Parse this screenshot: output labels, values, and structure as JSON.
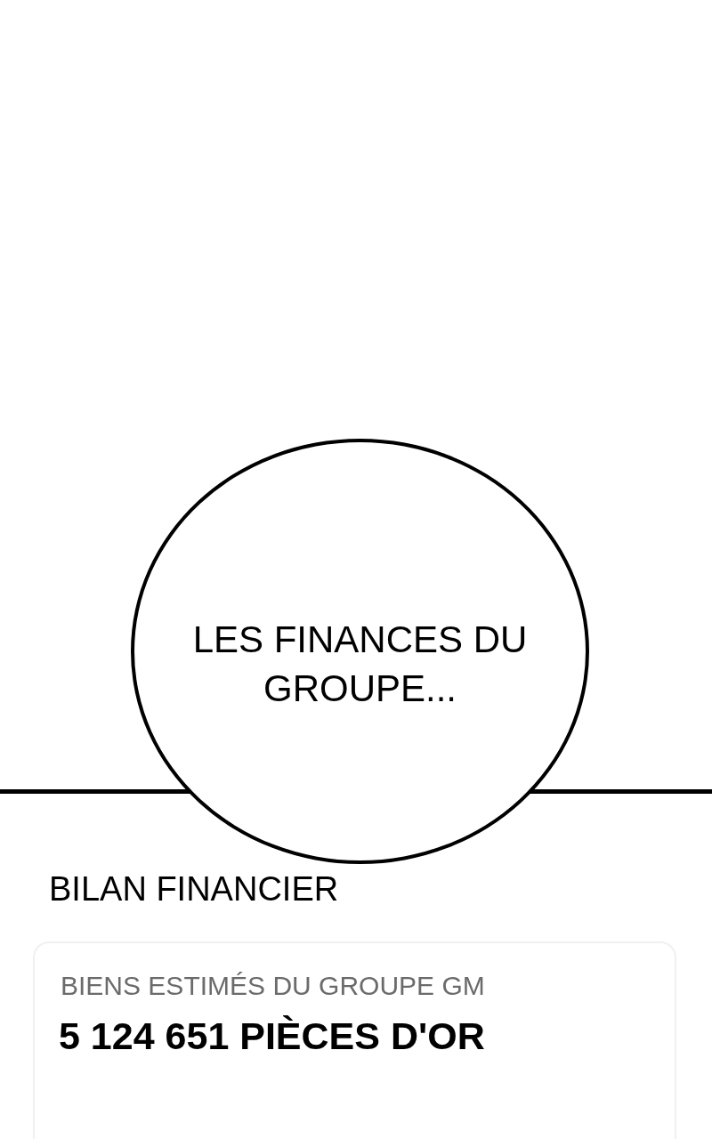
{
  "speech_bubble": {
    "text": "LES FINANCES DU GROUPE..."
  },
  "section_title": "BILAN FINANCIER",
  "card": {
    "label": "BIENS ESTIMÉS DU GROUPE GM",
    "value": "5 124 651 PIÈCES D'OR"
  }
}
